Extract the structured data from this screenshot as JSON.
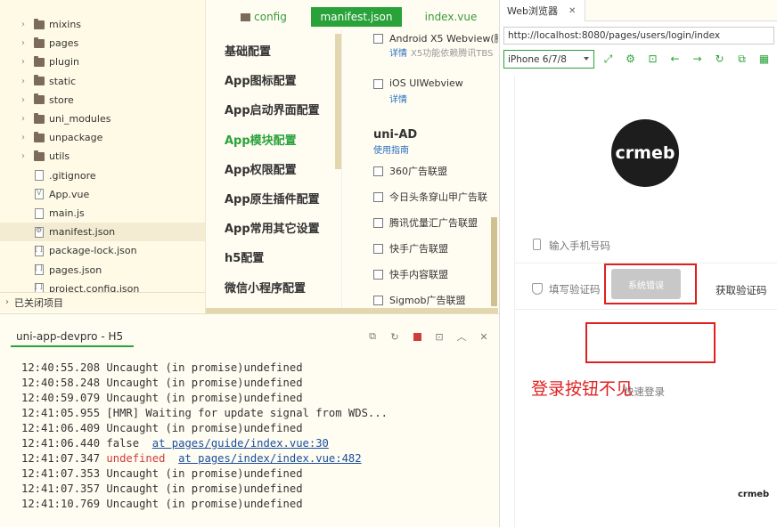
{
  "file_tree": {
    "items": [
      {
        "name": "mixins",
        "type": "folder"
      },
      {
        "name": "pages",
        "type": "folder"
      },
      {
        "name": "plugin",
        "type": "folder"
      },
      {
        "name": "static",
        "type": "folder"
      },
      {
        "name": "store",
        "type": "folder"
      },
      {
        "name": "uni_modules",
        "type": "folder"
      },
      {
        "name": "unpackage",
        "type": "folder"
      },
      {
        "name": "utils",
        "type": "folder"
      },
      {
        "name": ".gitignore",
        "type": "file"
      },
      {
        "name": "App.vue",
        "type": "file"
      },
      {
        "name": "main.js",
        "type": "file"
      },
      {
        "name": "manifest.json",
        "type": "file",
        "selected": true
      },
      {
        "name": "package-lock.json",
        "type": "file"
      },
      {
        "name": "pages.json",
        "type": "file"
      },
      {
        "name": "project.config.json",
        "type": "file"
      }
    ],
    "closed_projects": "已关闭项目"
  },
  "editor": {
    "tabs": [
      "config",
      "manifest.json",
      "index.vue"
    ],
    "nav": [
      "基础配置",
      "App图标配置",
      "App启动界面配置",
      "App模块配置",
      "App权限配置",
      "App原生插件配置",
      "App常用其它设置",
      "h5配置",
      "微信小程序配置"
    ],
    "active_nav": "App模块配置",
    "webview_x5": "Android X5 Webview(腾",
    "webview_x5_link": "详情",
    "webview_x5_hint": "X5功能依赖腾讯TBS",
    "ios_webview": "iOS UIWebview",
    "ios_webview_link": "详情",
    "uni_ad_title": "uni-AD",
    "uni_ad_link": "使用指南",
    "ad_options": [
      "360广告联盟",
      "今日头条穿山甲广告联",
      "腾讯优量汇广告联盟",
      "快手广告联盟",
      "快手内容联盟",
      "Sigmob广告联盟"
    ]
  },
  "console": {
    "tab": "uni-app-devpro - H5",
    "lines": [
      {
        "time": "12:40:55.208",
        "text": "Uncaught (in promise)undefined"
      },
      {
        "time": "12:40:58.248",
        "text": "Uncaught (in promise)undefined"
      },
      {
        "time": "12:40:59.079",
        "text": "Uncaught (in promise)undefined"
      },
      {
        "time": "12:41:05.955",
        "text": "[HMR] Waiting for update signal from WDS..."
      },
      {
        "time": "12:41:06.409",
        "text": "Uncaught (in promise)undefined"
      },
      {
        "time": "12:41:06.440",
        "text": "false",
        "link": "at pages/guide/index.vue:30"
      },
      {
        "time": "12:41:07.347",
        "text": "undefined",
        "red": true,
        "link": "at pages/index/index.vue:482"
      },
      {
        "time": "12:41:07.353",
        "text": "Uncaught (in promise)undefined"
      },
      {
        "time": "12:41:07.357",
        "text": "Uncaught (in promise)undefined"
      },
      {
        "time": "12:41:10.769",
        "text": "Uncaught (in promise)undefined"
      }
    ]
  },
  "browser": {
    "tab_title": "Web浏览器",
    "url": "http://localhost:8080/pages/users/login/index",
    "device": "iPhone 6/7/8",
    "logo_text": "crmeb",
    "phone_placeholder": "输入手机号码",
    "code_placeholder": "填写验证码",
    "error_toast": "系统错误",
    "get_code": "获取验证码",
    "annotation": "登录按钮不见",
    "quick_login": "快速登录",
    "mini_logo": "crmeb"
  }
}
